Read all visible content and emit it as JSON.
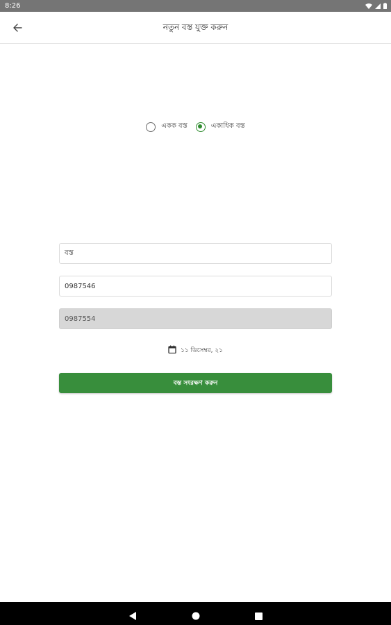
{
  "status_bar": {
    "time": "8:26",
    "icons": [
      "wifi-icon",
      "signal-icon",
      "battery-icon"
    ]
  },
  "app_bar": {
    "back_icon": "arrow-left-icon",
    "title": "নতুন বস্ত যুক্ত করুন"
  },
  "radio_group": {
    "options": [
      {
        "label": "একক বস্ত",
        "checked": false
      },
      {
        "label": "একাধিক বস্ত",
        "checked": true
      }
    ]
  },
  "form": {
    "name_value": "বস্ত",
    "first_code_value": "0987546",
    "second_code_value": "0987554",
    "date_icon": "calendar-icon",
    "date_text": "১১ ডিসেম্বর, ২১",
    "save_label": "বস্ত সংরক্ষণ করুন"
  },
  "colors": {
    "accent": "#388e3c",
    "status_bar": "#757575",
    "disabled_field": "#d7d7d7"
  },
  "nav_bar": {
    "icons": [
      "nav-back-icon",
      "nav-home-icon",
      "nav-recents-icon"
    ]
  }
}
